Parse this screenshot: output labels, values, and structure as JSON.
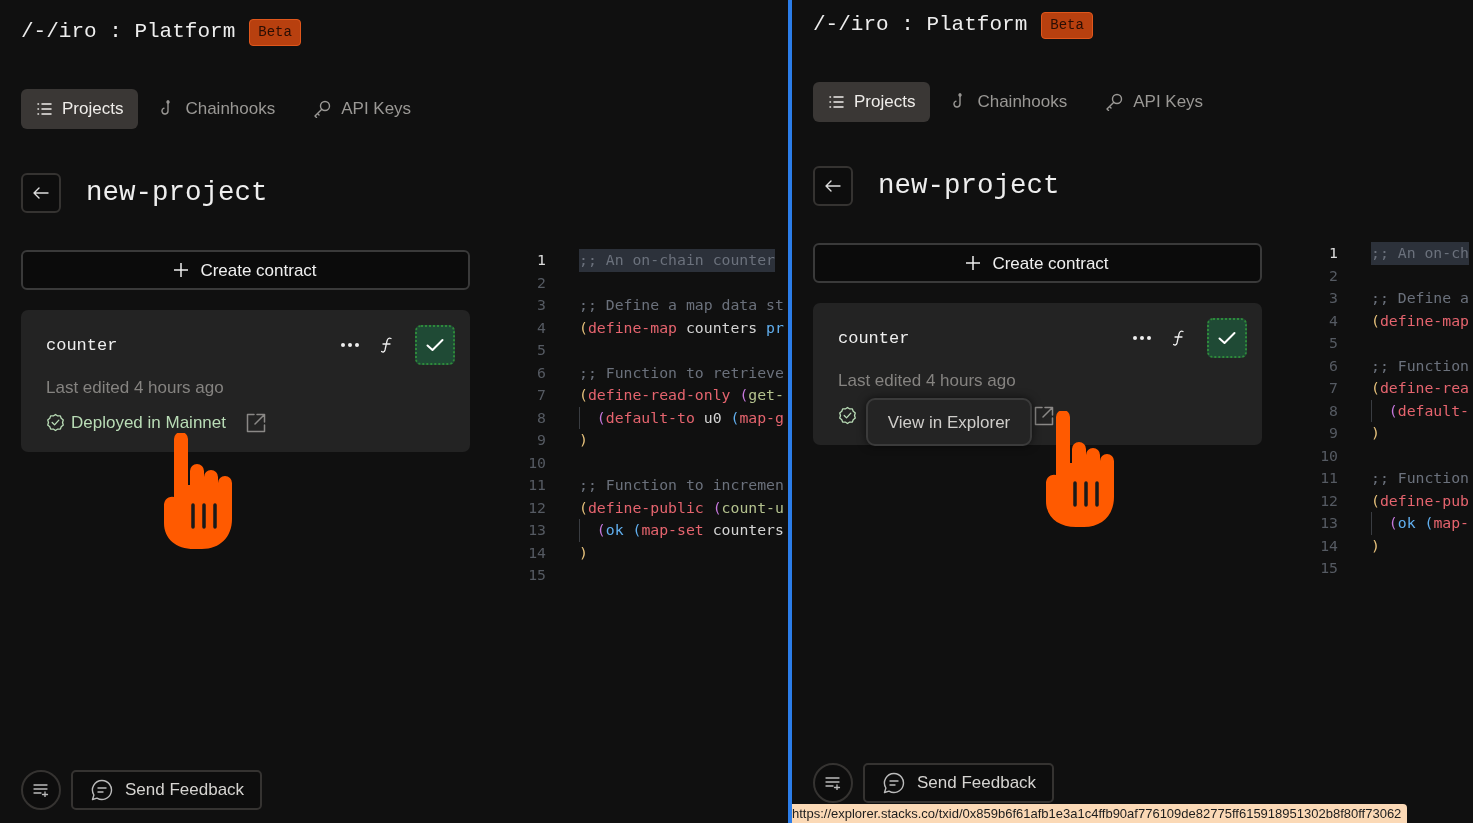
{
  "panes": [
    {
      "brand": "/-/iro : Platform",
      "badge": "Beta",
      "tabs": [
        {
          "label": "Projects",
          "selected": true
        },
        {
          "label": "Chainhooks",
          "selected": false
        },
        {
          "label": "API Keys",
          "selected": false
        }
      ],
      "title": "new-project",
      "create_button": "Create contract",
      "contract": {
        "name": "counter",
        "edited": "Last edited 4 hours ago",
        "deployed": true,
        "status": "Deployed in Mainnet"
      },
      "code": [
        {
          "n": "1",
          "highlighted": true,
          "tokens": [
            {
              "kind": "comment",
              "text": ";; An on-chain counter"
            }
          ]
        },
        {
          "n": "2",
          "highlighted": false
        },
        {
          "n": "3",
          "highlighted": false,
          "tokens": [
            {
              "kind": "comment",
              "text": ";; Define a map data st"
            }
          ]
        },
        {
          "n": "4",
          "highlighted": false,
          "tokens": [
            {
              "kind": "p1",
              "text": "("
            },
            {
              "kind": "keyword",
              "text": "define-map"
            },
            {
              "kind": "text",
              "text": " counters "
            },
            {
              "kind": "type",
              "text": "pr"
            }
          ]
        },
        {
          "n": "5",
          "highlighted": false
        },
        {
          "n": "6",
          "highlighted": false,
          "tokens": [
            {
              "kind": "comment",
              "text": ";; Function to retrieve"
            }
          ]
        },
        {
          "n": "7",
          "highlighted": false,
          "tokens": [
            {
              "kind": "p1",
              "text": "("
            },
            {
              "kind": "keyword",
              "text": "define-read-only"
            },
            {
              "kind": "p2",
              "text": " ("
            },
            {
              "kind": "name",
              "text": "get-"
            }
          ]
        },
        {
          "n": "8",
          "highlighted": false,
          "guide": true,
          "tokens": [
            {
              "kind": "p2",
              "text": "("
            },
            {
              "kind": "keyword",
              "text": "default-to"
            },
            {
              "kind": "text",
              "text": " u0 "
            },
            {
              "kind": "p3",
              "text": "("
            },
            {
              "kind": "keyword",
              "text": "map-g"
            }
          ]
        },
        {
          "n": "9",
          "highlighted": false,
          "tokens": [
            {
              "kind": "p1",
              "text": ")"
            }
          ]
        },
        {
          "n": "10",
          "highlighted": false
        },
        {
          "n": "11",
          "highlighted": false,
          "tokens": [
            {
              "kind": "comment",
              "text": ";; Function to incremen"
            }
          ]
        },
        {
          "n": "12",
          "highlighted": false,
          "tokens": [
            {
              "kind": "p1",
              "text": "("
            },
            {
              "kind": "keyword",
              "text": "define-public"
            },
            {
              "kind": "p2",
              "text": " ("
            },
            {
              "kind": "name",
              "text": "count-u"
            }
          ]
        },
        {
          "n": "13",
          "highlighted": false,
          "guide": true,
          "tokens": [
            {
              "kind": "p2",
              "text": "("
            },
            {
              "kind": "type",
              "text": "ok"
            },
            {
              "kind": "p3",
              "text": " ("
            },
            {
              "kind": "keyword",
              "text": "map-set"
            },
            {
              "kind": "text",
              "text": " counters"
            }
          ]
        },
        {
          "n": "14",
          "highlighted": false,
          "tokens": [
            {
              "kind": "p1",
              "text": ")"
            }
          ]
        },
        {
          "n": "15",
          "highlighted": false
        }
      ],
      "feedback_button": "Send Feedback"
    },
    {
      "brand": "/-/iro : Platform",
      "badge": "Beta",
      "tabs": [
        {
          "label": "Projects",
          "selected": true
        },
        {
          "label": "Chainhooks",
          "selected": false
        },
        {
          "label": "API Keys",
          "selected": false
        }
      ],
      "title": "new-project",
      "create_button": "Create contract",
      "contract": {
        "name": "counter",
        "edited": "Last edited 4 hours ago",
        "deployed": true
      },
      "tooltip": "View in Explorer",
      "code": [
        {
          "n": "1",
          "highlighted": true,
          "tokens": [
            {
              "kind": "comment",
              "text": ";; An on-ch"
            }
          ]
        },
        {
          "n": "2",
          "highlighted": false
        },
        {
          "n": "3",
          "highlighted": false,
          "tokens": [
            {
              "kind": "comment",
              "text": ";; Define a"
            }
          ]
        },
        {
          "n": "4",
          "highlighted": false,
          "tokens": [
            {
              "kind": "p1",
              "text": "("
            },
            {
              "kind": "keyword",
              "text": "define-map"
            }
          ]
        },
        {
          "n": "5",
          "highlighted": false
        },
        {
          "n": "6",
          "highlighted": false,
          "tokens": [
            {
              "kind": "comment",
              "text": ";; Function"
            }
          ]
        },
        {
          "n": "7",
          "highlighted": false,
          "tokens": [
            {
              "kind": "p1",
              "text": "("
            },
            {
              "kind": "keyword",
              "text": "define-rea"
            }
          ]
        },
        {
          "n": "8",
          "highlighted": false,
          "guide": true,
          "tokens": [
            {
              "kind": "p2",
              "text": "("
            },
            {
              "kind": "keyword",
              "text": "default-"
            }
          ]
        },
        {
          "n": "9",
          "highlighted": false,
          "tokens": [
            {
              "kind": "p1",
              "text": ")"
            }
          ]
        },
        {
          "n": "10",
          "highlighted": false
        },
        {
          "n": "11",
          "highlighted": false,
          "tokens": [
            {
              "kind": "comment",
              "text": ";; Function"
            }
          ]
        },
        {
          "n": "12",
          "highlighted": false,
          "tokens": [
            {
              "kind": "p1",
              "text": "("
            },
            {
              "kind": "keyword",
              "text": "define-pub"
            }
          ]
        },
        {
          "n": "13",
          "highlighted": false,
          "guide": true,
          "tokens": [
            {
              "kind": "p2",
              "text": "("
            },
            {
              "kind": "type",
              "text": "ok"
            },
            {
              "kind": "p3",
              "text": " ("
            },
            {
              "kind": "keyword",
              "text": "map-"
            }
          ]
        },
        {
          "n": "14",
          "highlighted": false,
          "tokens": [
            {
              "kind": "p1",
              "text": ")"
            }
          ]
        },
        {
          "n": "15",
          "highlighted": false
        }
      ],
      "feedback_button": "Send Feedback",
      "status_url": "https://explorer.stacks.co/txid/0x859b6f61afb1e3a1c4ffb90af776109de82775ff615918951302b8f80ff73062"
    }
  ]
}
